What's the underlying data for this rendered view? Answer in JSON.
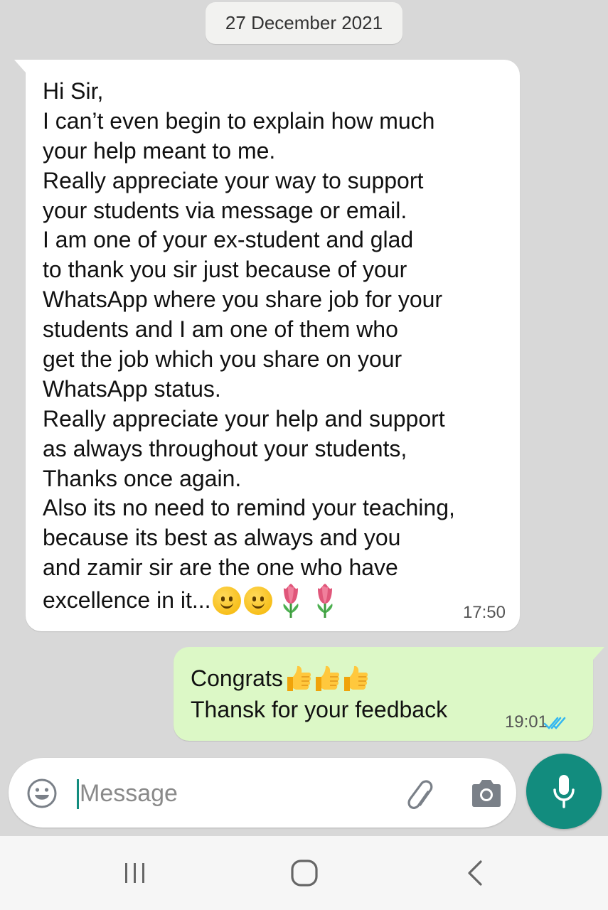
{
  "date_chip": "27 December 2021",
  "incoming": {
    "lines": [
      "Hi Sir,",
      "I can’t even begin to explain how much",
      "your help meant to me.",
      "Really appreciate your way to support",
      "your students via message or email.",
      "I am one of your ex-student and glad",
      "to thank you sir just because of your",
      "WhatsApp where you share job for your",
      "students and I am one of them who",
      "get the job which you share on your",
      "WhatsApp status.",
      "Really appreciate your help and support",
      "as always throughout your students,",
      "Thanks once again.",
      "Also its no need to remind your teaching,",
      "because its best as always and you",
      "and zamir sir are the one who have",
      "excellence in it..."
    ],
    "emojis": [
      "smiling-face",
      "smiling-face",
      "tulip",
      "tulip"
    ],
    "time": "17:50"
  },
  "outgoing": {
    "line1": "Congrats",
    "line1_emojis": [
      "thumbs-up",
      "thumbs-up",
      "thumbs-up"
    ],
    "line2": "Thansk for your feedback",
    "time": "19:01",
    "status": "read-double-tick"
  },
  "composer": {
    "placeholder": "Message"
  },
  "colors": {
    "chat_background": "#d8d8d8",
    "incoming_bubble": "#ffffff",
    "outgoing_bubble": "#dcf8c6",
    "accent": "#128c7e",
    "read_tick": "#34b7f1"
  }
}
